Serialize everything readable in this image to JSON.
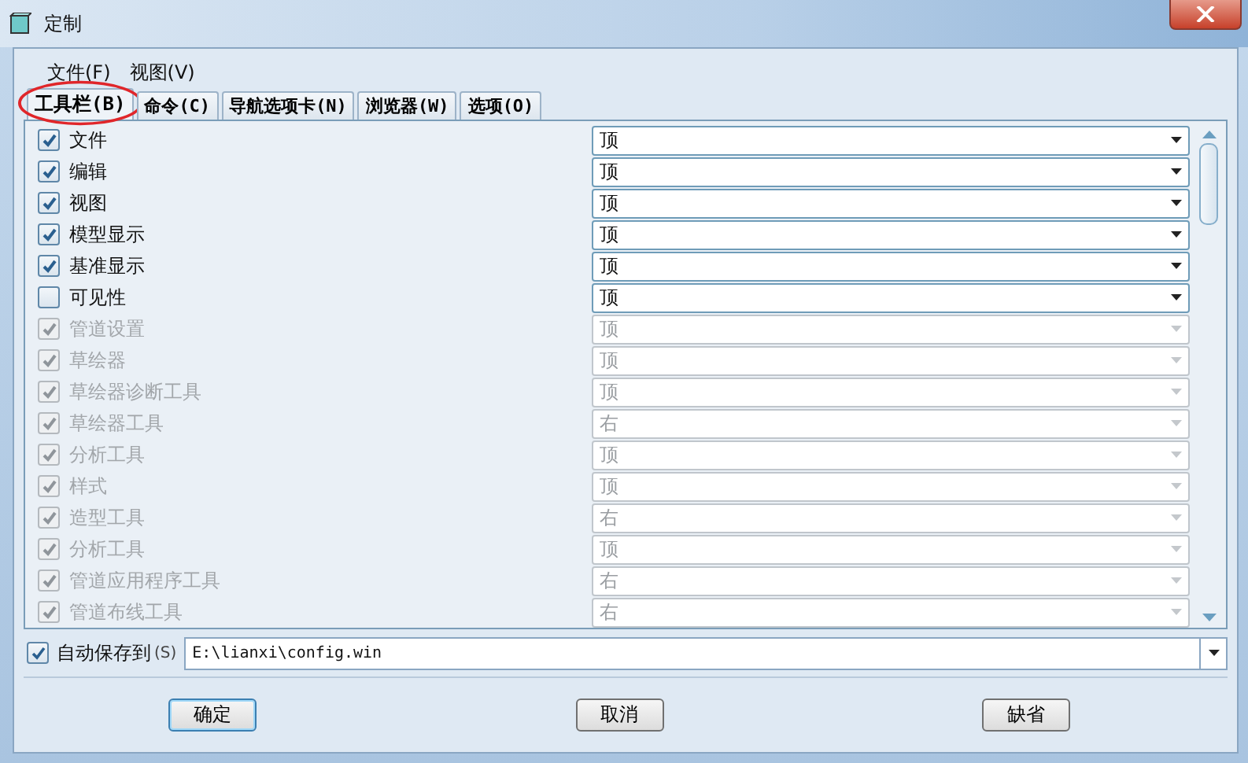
{
  "window": {
    "title": "定制"
  },
  "menu": [
    "文件(F)",
    "视图(V)"
  ],
  "tabs": [
    {
      "label": "工具栏(B)",
      "selected": true,
      "circled": true
    },
    {
      "label": "命令(C)",
      "selected": false,
      "circled": false
    },
    {
      "label": "导航选项卡(N)",
      "selected": false,
      "circled": false
    },
    {
      "label": "浏览器(W)",
      "selected": false,
      "circled": false
    },
    {
      "label": "选项(O)",
      "selected": false,
      "circled": false
    }
  ],
  "toolbars": [
    {
      "name": "文件",
      "checked": true,
      "disabled": false,
      "position": "顶"
    },
    {
      "name": "编辑",
      "checked": true,
      "disabled": false,
      "position": "顶"
    },
    {
      "name": "视图",
      "checked": true,
      "disabled": false,
      "position": "顶"
    },
    {
      "name": "模型显示",
      "checked": true,
      "disabled": false,
      "position": "顶"
    },
    {
      "name": "基准显示",
      "checked": true,
      "disabled": false,
      "position": "顶"
    },
    {
      "name": "可见性",
      "checked": false,
      "disabled": false,
      "position": "顶"
    },
    {
      "name": "管道设置",
      "checked": true,
      "disabled": true,
      "position": "顶"
    },
    {
      "name": "草绘器",
      "checked": true,
      "disabled": true,
      "position": "顶"
    },
    {
      "name": "草绘器诊断工具",
      "checked": true,
      "disabled": true,
      "position": "顶"
    },
    {
      "name": "草绘器工具",
      "checked": true,
      "disabled": true,
      "position": "右"
    },
    {
      "name": "分析工具",
      "checked": true,
      "disabled": true,
      "position": "顶"
    },
    {
      "name": "样式",
      "checked": true,
      "disabled": true,
      "position": "顶"
    },
    {
      "name": "造型工具",
      "checked": true,
      "disabled": true,
      "position": "右"
    },
    {
      "name": "分析工具",
      "checked": true,
      "disabled": true,
      "position": "顶"
    },
    {
      "name": "管道应用程序工具",
      "checked": true,
      "disabled": true,
      "position": "右"
    },
    {
      "name": "管道布线工具",
      "checked": true,
      "disabled": true,
      "position": "右"
    }
  ],
  "autosave": {
    "label": "自动保存到",
    "shortcut": "(S)",
    "checked": true,
    "value": "E:\\lianxi\\config.win"
  },
  "buttons": [
    "确定",
    "取消",
    "缺省"
  ]
}
